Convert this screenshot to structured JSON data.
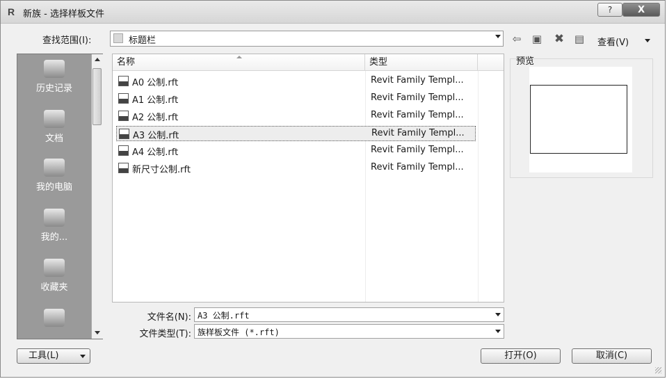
{
  "window": {
    "title": "新族 - 选择样板文件",
    "app_icon": "R"
  },
  "titlebar": {
    "help_label": "?",
    "close_label": "X"
  },
  "lookin": {
    "label": "查找范围(I):",
    "value": "标题栏"
  },
  "toolbar": {
    "view_label": "查看(V)"
  },
  "places": [
    {
      "label": "历史记录",
      "icon": "history-icon"
    },
    {
      "label": "文档",
      "icon": "documents-icon"
    },
    {
      "label": "我的电脑",
      "icon": "computer-icon"
    },
    {
      "label": "我的...",
      "icon": "network-icon"
    },
    {
      "label": "收藏夹",
      "icon": "favorites-icon"
    }
  ],
  "filelist": {
    "headers": {
      "name": "名称",
      "type": "类型"
    },
    "rows": [
      {
        "name": "A0 公制.rft",
        "type": "Revit Family Templ..."
      },
      {
        "name": "A1 公制.rft",
        "type": "Revit Family Templ..."
      },
      {
        "name": "A2 公制.rft",
        "type": "Revit Family Templ..."
      },
      {
        "name": "A3 公制.rft",
        "type": "Revit Family Templ...",
        "selected": true
      },
      {
        "name": "A4 公制.rft",
        "type": "Revit Family Templ..."
      },
      {
        "name": "新尺寸公制.rft",
        "type": "Revit Family Templ..."
      }
    ]
  },
  "preview": {
    "label": "预览"
  },
  "filename": {
    "label": "文件名(N):",
    "value": "A3 公制.rft"
  },
  "filetype": {
    "label": "文件类型(T):",
    "value": "族样板文件 (*.rft)"
  },
  "buttons": {
    "tools": "工具(L)",
    "open": "打开(O)",
    "cancel": "取消(C)"
  }
}
